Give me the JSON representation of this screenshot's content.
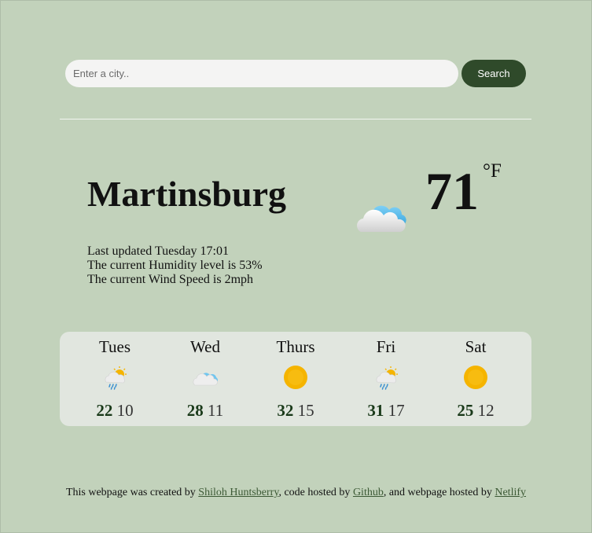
{
  "search": {
    "placeholder": "Enter a city..",
    "button_label": "Search"
  },
  "current": {
    "city": "Martinsburg",
    "temperature": "71",
    "unit": "°F",
    "icon": "cloud-sun-icon",
    "last_updated": "Last updated Tuesday 17:01",
    "humidity": "The current Humidity level is 53%",
    "wind": "The current Wind Speed is 2mph"
  },
  "forecast": [
    {
      "day": "Tues",
      "icon": "sun-rain-icon",
      "high": "22",
      "low": "10"
    },
    {
      "day": "Wed",
      "icon": "cloud-icon",
      "high": "28",
      "low": "11"
    },
    {
      "day": "Thurs",
      "icon": "sun-icon",
      "high": "32",
      "low": "15"
    },
    {
      "day": "Fri",
      "icon": "sun-rain-icon",
      "high": "31",
      "low": "17"
    },
    {
      "day": "Sat",
      "icon": "sun-icon",
      "high": "25",
      "low": "12"
    }
  ],
  "footer": {
    "prefix": "This webpage was created by ",
    "author": "Shiloh Huntsberry",
    "middle": ", code hosted by ",
    "github": "Github",
    "middle2": ", and webpage hosted by ",
    "netlify": "Netlify"
  },
  "colors": {
    "background": "#c2d2bb",
    "button": "#2f4a2a",
    "forecast_panel": "#e1e6df"
  }
}
